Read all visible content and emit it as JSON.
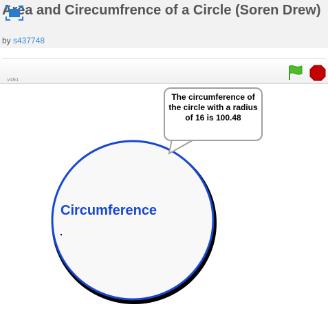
{
  "project": {
    "title": "Area and Cirecumfrence of a Circle (Soren Drew)",
    "by_prefix": "by",
    "author": "s437748"
  },
  "player": {
    "version": "v461",
    "fullscreen_icon": "fullscreen-icon",
    "flag_icon": "green-flag-icon",
    "stop_icon": "stop-sign-icon",
    "colors": {
      "flag": "#4cbf26",
      "stop": "#c40000"
    }
  },
  "stage": {
    "sprite_label": "Circumference",
    "speech_bubble": "The circumference of the circle with a radius of 16 is 100.48",
    "colors": {
      "circle_outline": "#1746d1",
      "circle_fill": "#f8f8f8",
      "label": "#1746d1"
    }
  }
}
